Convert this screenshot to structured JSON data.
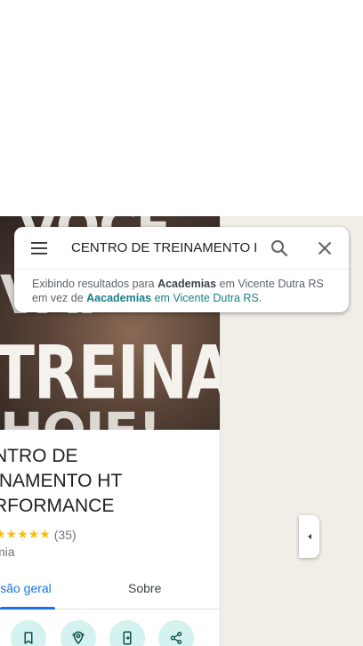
{
  "search": {
    "query": "CENTRO DE TREINAMENTO HT",
    "showing_prefix": "Exibindo resultados para ",
    "showing_term": "Academias",
    "showing_location": " em Vicente Dutra RS",
    "instead_prefix": "em vez de ",
    "instead_term": "Aacademias",
    "instead_location": " em Vicente Dutra RS",
    "instead_suffix": "."
  },
  "hero": {
    "line1": "VOCÊ",
    "line2": "VAI",
    "line3": "TREINAR",
    "line4": "HOJE!"
  },
  "place": {
    "title_line1": "NTRO DE",
    "title_line2": "INAMENTO HT",
    "title_line3": "RFORMANCE",
    "stars_text": "★★★★★",
    "rating_value": 5,
    "review_count": "(35)",
    "category": "mia"
  },
  "tabs": {
    "overview": "Visão geral",
    "about": "Sobre"
  },
  "actions": [
    {
      "name": "save",
      "icon": "bookmark-icon"
    },
    {
      "name": "nearby",
      "icon": "nearby-pin-icon"
    },
    {
      "name": "send-to-phone",
      "icon": "send-to-phone-icon"
    },
    {
      "name": "share",
      "icon": "share-icon"
    }
  ],
  "colors": {
    "accent_blue": "#1a73e8",
    "teal_link": "#1a7f85",
    "action_bg": "#d4f2ef",
    "star_yellow": "#fbbc04",
    "map_bg": "#f1eee7"
  }
}
